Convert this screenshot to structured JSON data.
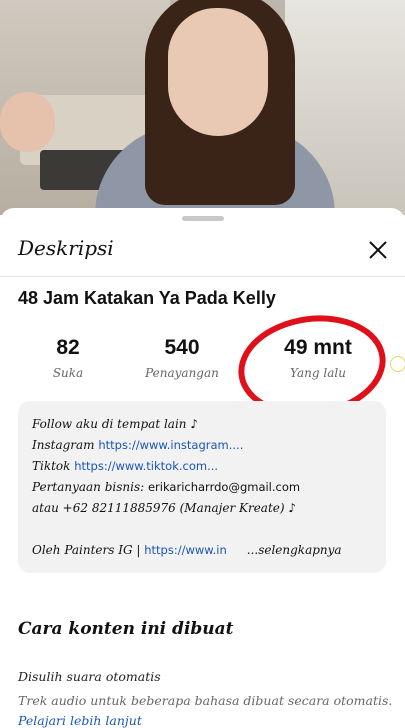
{
  "header": {
    "title": "Deskripsi",
    "close_icon": "close-icon"
  },
  "video": {
    "title": "48 Jam Katakan Ya Pada Kelly",
    "stats": [
      {
        "value": "82",
        "label": "Suka"
      },
      {
        "value": "540",
        "label": "Penayangan"
      },
      {
        "value": "49 mnt",
        "label": "Yang lalu"
      }
    ]
  },
  "description": {
    "line1": "Follow aku di tempat lain ♪",
    "line2_prefix": "Instagram ",
    "line2_link": "https://www.instagram....",
    "line3_prefix": "Tiktok ",
    "line3_link": "https://www.tiktok.com...",
    "line4_prefix": "Pertanyaan bisnis: ",
    "line4_email": "erikaricharrdo@gmail.com",
    "line5": "atau +62 82111885976 (Manajer Kreate) ♪",
    "line6_prefix": "Oleh Painters IG | ",
    "line6_link": "https://www.in",
    "line6_more": "...selengkapnya"
  },
  "section": {
    "title": "Cara konten ini dibuat",
    "item_title": "Disulih suara otomatis",
    "item_desc": "Trek audio untuk beberapa bahasa dibuat secara otomatis.",
    "item_link": "Pelajari lebih lanjut"
  },
  "colors": {
    "annotation": "#e0101b",
    "link": "#1a55b8"
  }
}
